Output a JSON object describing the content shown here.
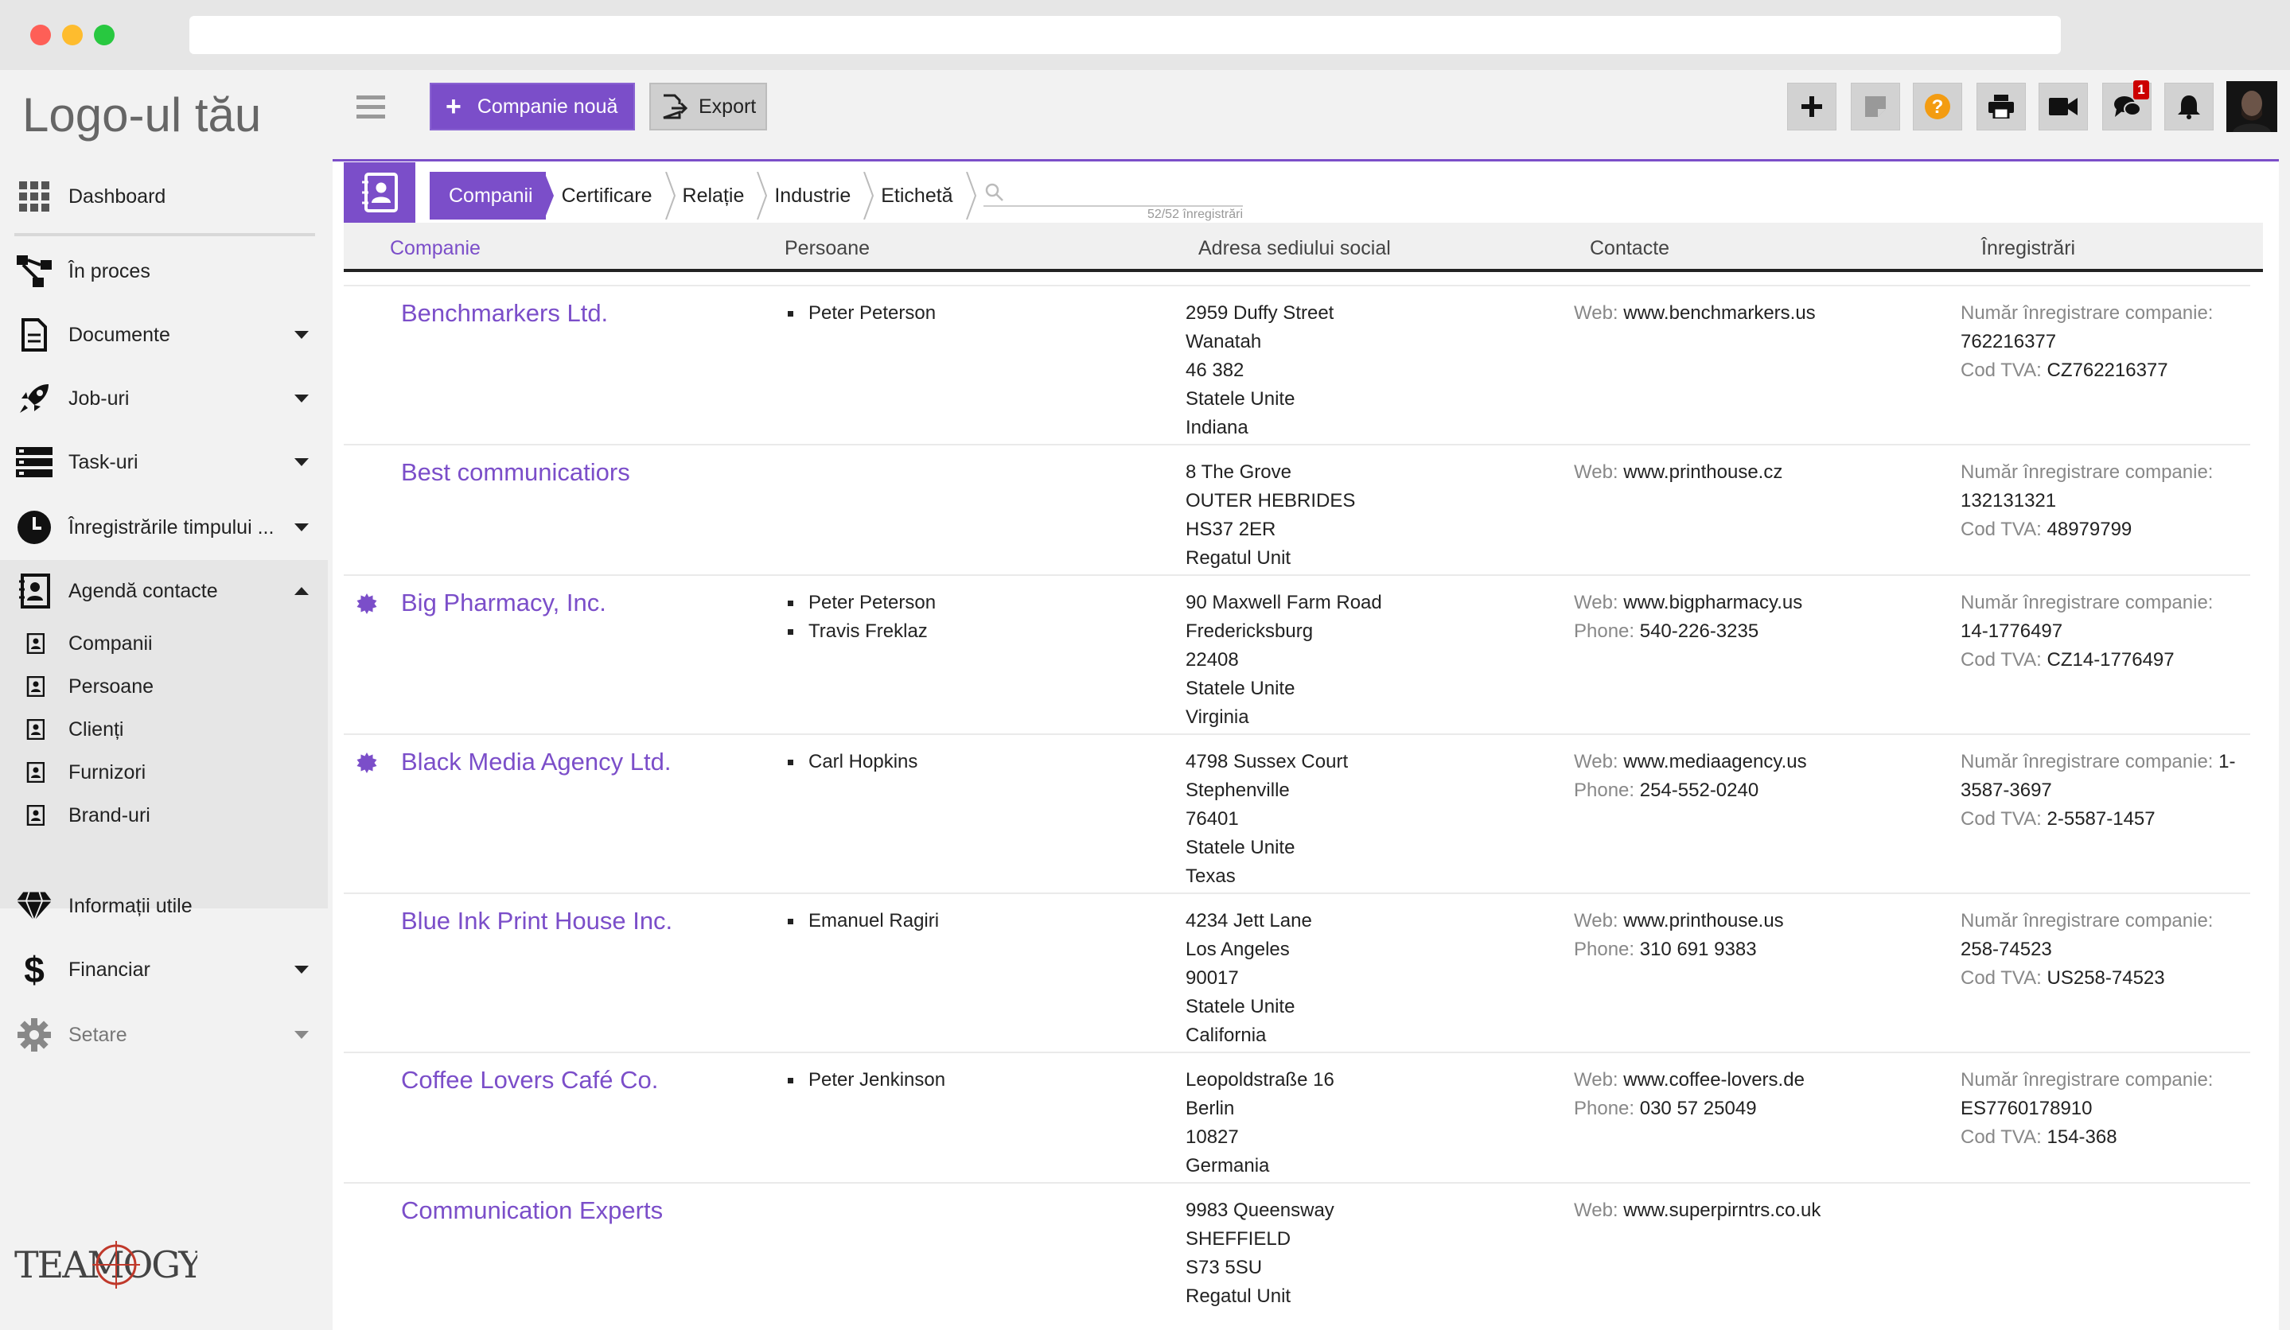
{
  "app": {
    "logo": "Logo-ul tău",
    "brand": "TEAMOGY"
  },
  "sidebar": {
    "items": [
      {
        "label": "Dashboard",
        "icon": "grid-icon"
      },
      {
        "label": "În proces",
        "icon": "workflow-icon"
      },
      {
        "label": "Documente",
        "icon": "document-icon"
      },
      {
        "label": "Job-uri",
        "icon": "rocket-icon"
      },
      {
        "label": "Task-uri",
        "icon": "tasks-icon"
      },
      {
        "label": "Înregistrările timpului ...",
        "icon": "clock-icon"
      },
      {
        "label": "Agendă contacte",
        "icon": "contacts-icon"
      },
      {
        "label": "Informații utile",
        "icon": "diamond-icon"
      },
      {
        "label": "Financiar",
        "icon": "dollar-icon"
      },
      {
        "label": "Setare",
        "icon": "gear-icon"
      }
    ],
    "subitems": [
      {
        "label": "Companii"
      },
      {
        "label": "Persoane"
      },
      {
        "label": "Clienți"
      },
      {
        "label": "Furnizori"
      },
      {
        "label": "Brand-uri"
      }
    ]
  },
  "toolbar": {
    "new_label": "Companie nouă",
    "export_label": "Export",
    "chat_badge": "1"
  },
  "colors": {
    "accent": "#7b4ec9",
    "help": "#f39c12",
    "badge": "#cc0000"
  },
  "tabs": [
    {
      "label": "Companii"
    },
    {
      "label": "Certificare"
    },
    {
      "label": "Relație"
    },
    {
      "label": "Industrie"
    },
    {
      "label": "Etichetă"
    }
  ],
  "search": {
    "count": "52/52 înregistrări"
  },
  "table": {
    "columns": [
      "Companie",
      "Persoane",
      "Adresa sediului social",
      "Contacte",
      "Înregistrări"
    ],
    "labels": {
      "web": "Web: ",
      "phone": "Phone: ",
      "reg": "Număr înregistrare companie: ",
      "vat": "Cod TVA: "
    },
    "rows": [
      {
        "name": "Benchmarkers Ltd.",
        "starred": false,
        "people": [
          "Peter Peterson"
        ],
        "address": [
          "2959 Duffy Street",
          "Wanatah",
          "46 382",
          "Statele Unite",
          "Indiana"
        ],
        "web": "www.benchmarkers.us",
        "phone": "",
        "reg_lead": "",
        "reg_tail": "762216377",
        "vat": "CZ762216377"
      },
      {
        "name": "Best communicatiors",
        "starred": false,
        "people": [],
        "address": [
          "8 The Grove",
          "OUTER HEBRIDES",
          "HS37 2ER",
          "Regatul Unit"
        ],
        "web": "www.printhouse.cz",
        "phone": "",
        "reg_lead": "",
        "reg_tail": "132131321",
        "vat": "48979799"
      },
      {
        "name": "Big Pharmacy, Inc.",
        "starred": true,
        "people": [
          "Peter Peterson",
          "Travis Freklaz"
        ],
        "address": [
          "90 Maxwell Farm Road",
          "Fredericksburg",
          "22408",
          "Statele Unite",
          "Virginia"
        ],
        "web": "www.bigpharmacy.us",
        "phone": "540-226-3235",
        "reg_lead": "",
        "reg_tail": "14-1776497",
        "vat": "CZ14-1776497"
      },
      {
        "name": "Black Media Agency Ltd.",
        "starred": true,
        "people": [
          "Carl Hopkins"
        ],
        "address": [
          "4798 Sussex Court",
          "Stephenville",
          "76401",
          "Statele Unite",
          "Texas"
        ],
        "web": "www.mediaagency.us",
        "phone": "254-552-0240",
        "reg_lead": "1-",
        "reg_tail": "3587-3697",
        "vat": "2-5587-1457"
      },
      {
        "name": "Blue Ink Print House Inc.",
        "starred": false,
        "people": [
          "Emanuel Ragiri"
        ],
        "address": [
          "4234 Jett Lane",
          "Los Angeles",
          "90017",
          "Statele Unite",
          "California"
        ],
        "web": "www.printhouse.us",
        "phone": "310 691 9383",
        "reg_lead": "",
        "reg_tail": "258-74523",
        "vat": "US258-74523"
      },
      {
        "name": "Coffee Lovers Café Co.",
        "starred": false,
        "people": [
          "Peter Jenkinson"
        ],
        "address": [
          "Leopoldstraße 16",
          "Berlin",
          "10827",
          "Germania"
        ],
        "web": "www.coffee-lovers.de",
        "phone": "030 57 25049",
        "reg_lead": "",
        "reg_tail": "ES7760178910",
        "vat": "154-368"
      },
      {
        "name": "Communication Experts",
        "starred": false,
        "people": [],
        "address": [
          "9983 Queensway",
          "SHEFFIELD",
          "S73 5SU",
          "Regatul Unit"
        ],
        "web": "www.superpirntrs.co.uk",
        "phone": "",
        "reg_lead": "",
        "reg_tail": "",
        "vat": ""
      }
    ]
  }
}
